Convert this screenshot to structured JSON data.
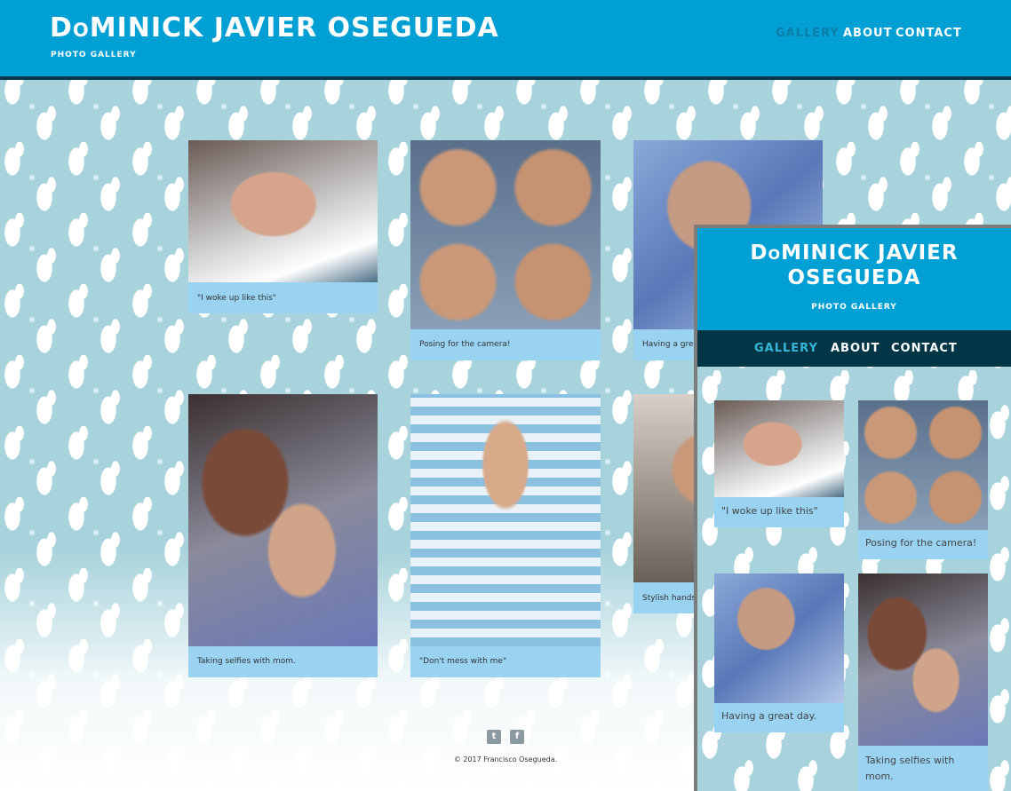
{
  "header": {
    "title": "DoMINICK JAVIER OSEGUEDA",
    "subtitle": "PHOTO GALLERY",
    "nav": [
      "GALLERY",
      "ABOUT",
      "CONTACT"
    ]
  },
  "gallery": {
    "captions": [
      "\"I woke up like this\"",
      "Posing for the camera!",
      "Having a great day.",
      "Taking selfies with mom.",
      "\"Don't mess with me\"",
      "Stylish hands"
    ]
  },
  "footer": {
    "copyright": "© 2017 Francisco Osegueda."
  },
  "preview": {
    "title_line1": "DoMINICK JAVIER",
    "title_line2": "OSEGUEDA",
    "subtitle": "PHOTO GALLERY",
    "nav": [
      "GALLERY",
      "ABOUT",
      "CONTACT"
    ],
    "captions": [
      "\"I woke up like this\"",
      "Posing for the camera!",
      "Having a great day.",
      "Taking selfies with mom."
    ]
  },
  "colors": {
    "header": "#009fd4",
    "header_border": "#003646",
    "caption_bg": "#9ad3f2",
    "active_nav": "#0d7fa6"
  },
  "icons": [
    "twitter-icon",
    "facebook-icon"
  ]
}
